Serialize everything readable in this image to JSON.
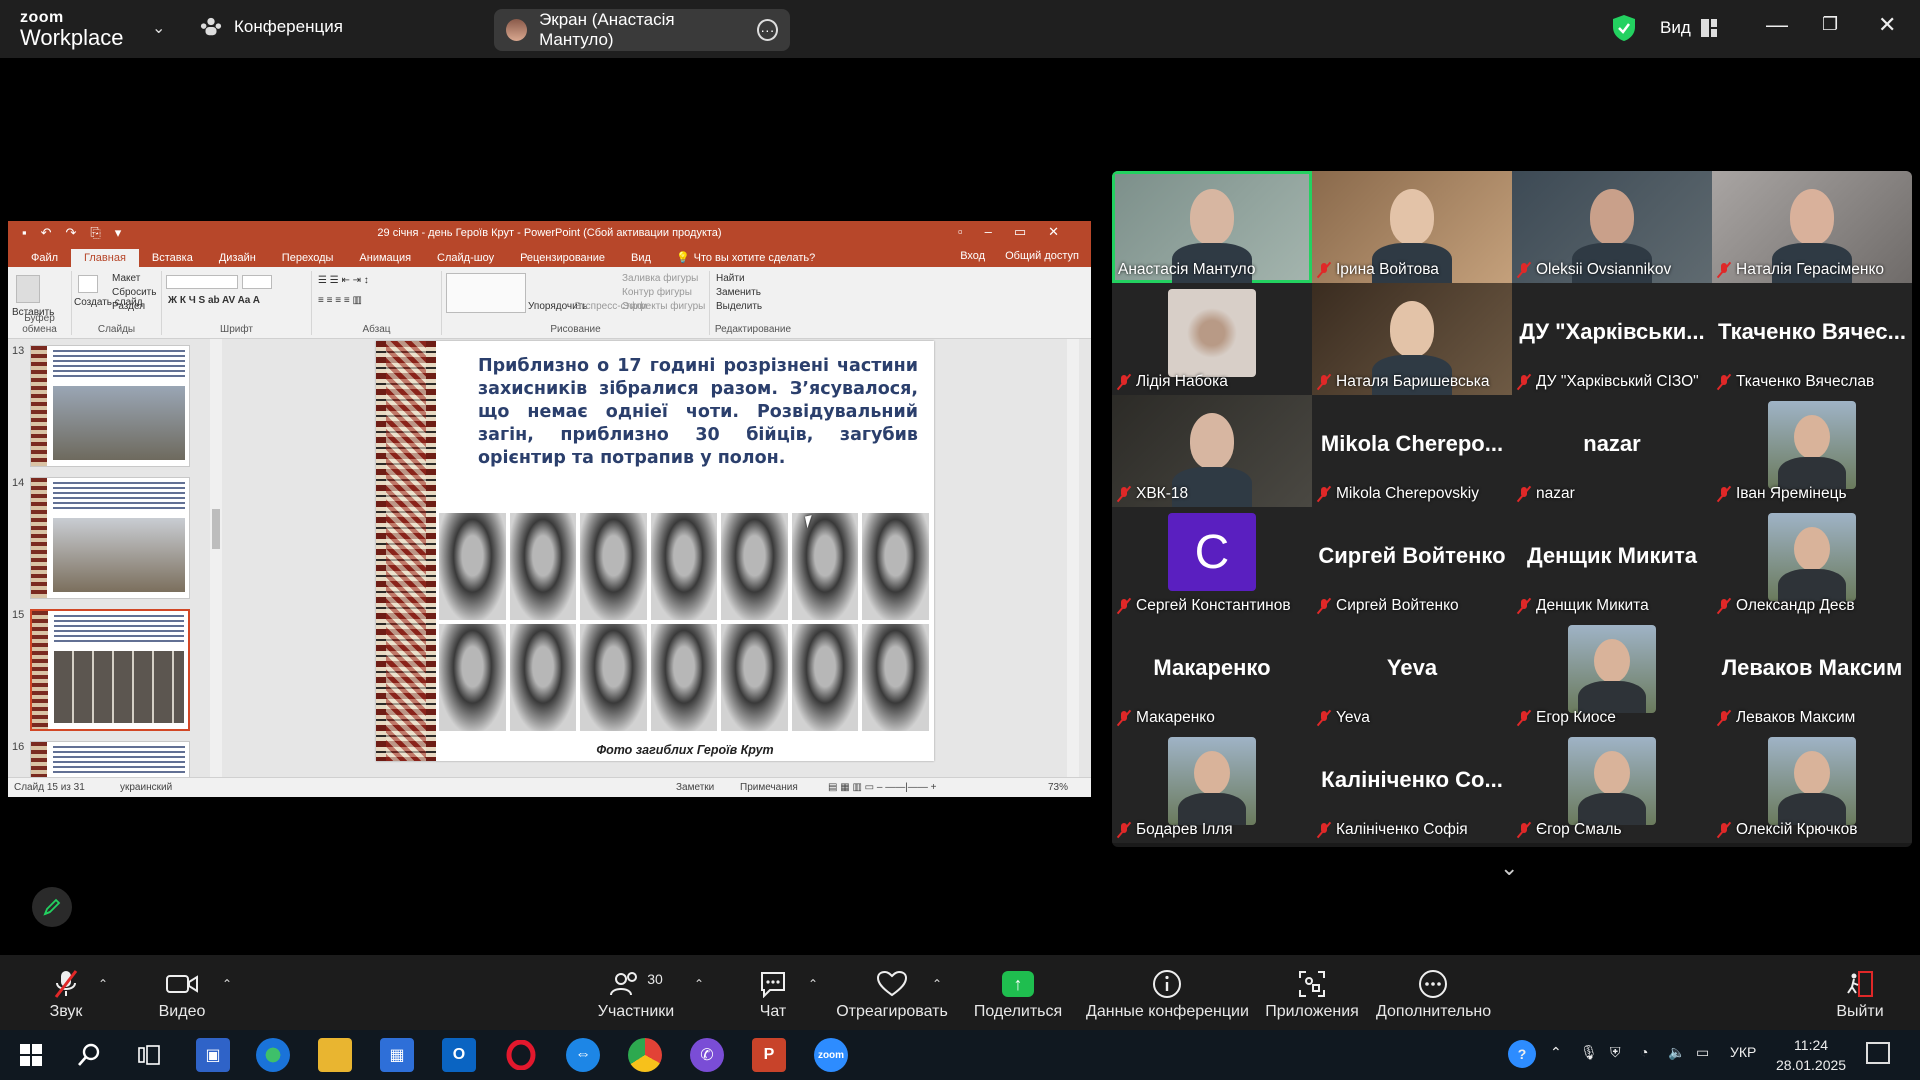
{
  "titlebar": {
    "logo_line1": "zoom",
    "logo_line2": "Workplace",
    "meeting_label": "Конференция",
    "screen_share_label": "Экран (Анастасія Мантуло)",
    "view_label": "Вид",
    "security_color": "#23d160"
  },
  "ppt": {
    "window_title": "29 січня - день Героїв Крут - PowerPoint (Сбой активации продукта)",
    "tabs": [
      "Файл",
      "Главная",
      "Вставка",
      "Дизайн",
      "Переходы",
      "Анимация",
      "Слайд-шоу",
      "Рецензирование",
      "Вид"
    ],
    "active_tab": "Главная",
    "tell_me": "Что вы хотите сделать?",
    "sign_in": "Вход",
    "share": "Общий доступ",
    "ribbon": {
      "paste": "Вставить",
      "clipboard": "Буфер обмена",
      "new_slide": "Создать слайд",
      "layout": "Макет",
      "reset": "Сбросить",
      "section": "Раздел",
      "slides": "Слайды",
      "font": "Шрифт",
      "paragraph": "Абзац",
      "arrange": "Упорядочить",
      "quick_styles": "Экспресс-стили",
      "shape_fill": "Заливка фигуры",
      "shape_outline": "Контур фигуры",
      "shape_effects": "Эффекты фигуры",
      "drawing": "Рисование",
      "find": "Найти",
      "replace": "Заменить",
      "select": "Выделить",
      "editing": "Редактирование"
    },
    "thumbnails": [
      {
        "num": "13",
        "selected": false
      },
      {
        "num": "14",
        "selected": false
      },
      {
        "num": "15",
        "selected": true
      },
      {
        "num": "16",
        "selected": false
      }
    ],
    "slide_text": "Приблизно о 17 годині розрізнені частини захисників зібралися разом. З’ясувалося, що немає одніеї чоти. Розвідувальний загін, приблизно 30 бійців, загубив орієнтир та потрапив у полон.",
    "slide_caption": "Фото загиблих Героїв Крут",
    "status_slide": "Слайд 15 из 31",
    "status_lang": "украинский",
    "status_notes": "Заметки",
    "status_comments": "Примечания",
    "status_zoom": "73%"
  },
  "gallery": {
    "participants": [
      {
        "name": "Анастасія Мантуло",
        "type": "video",
        "active": true
      },
      {
        "name": "Ірина Войтова",
        "type": "video"
      },
      {
        "name": "Oleksii Ovsiannikov",
        "type": "video"
      },
      {
        "name": "Наталія Герасіменко",
        "type": "video"
      },
      {
        "name": "Лідія Набока",
        "type": "photo"
      },
      {
        "name": "Наталя Баришевська",
        "type": "video"
      },
      {
        "name": "ДУ \"Харківський СІЗО\"",
        "big": "ДУ \"Харківськи...",
        "type": "text"
      },
      {
        "name": "Ткаченко Вячеслав",
        "big": "Ткаченко Вячес...",
        "type": "text"
      },
      {
        "name": "ХВК-18",
        "type": "video"
      },
      {
        "name": "Mikola Cherepovskiy",
        "big": "Mikola Cherepo...",
        "type": "text"
      },
      {
        "name": "nazar",
        "big": "nazar",
        "type": "text"
      },
      {
        "name": "Іван Яремінець",
        "type": "photo"
      },
      {
        "name": "Сергей Константинов",
        "type": "avatar",
        "initial": "C"
      },
      {
        "name": "Сиргей Войтенко",
        "big": "Сиргей Войтенко",
        "type": "text"
      },
      {
        "name": "Денщик Микита",
        "big": "Денщик Микита",
        "type": "text"
      },
      {
        "name": "Олександр Деєв",
        "type": "photo"
      },
      {
        "name": "Макаренко",
        "big": "Макаренко",
        "type": "text"
      },
      {
        "name": "Yeva",
        "big": "Yeva",
        "type": "text"
      },
      {
        "name": "Егор Киосе",
        "type": "photo"
      },
      {
        "name": "Леваков Максим",
        "big": "Леваков Максим",
        "type": "text"
      },
      {
        "name": "Бодарев Ілля",
        "type": "photo"
      },
      {
        "name": "Калініченко Софія",
        "big": "Калініченко Со...",
        "type": "text"
      },
      {
        "name": "Єгор Смаль",
        "type": "photo"
      },
      {
        "name": "Олексій Крючков",
        "type": "photo"
      }
    ]
  },
  "toolbar": {
    "mute": "Звук",
    "video": "Видео",
    "participants": "Участники",
    "participants_count": "30",
    "chat": "Чат",
    "react": "Отреагировать",
    "share": "Поделиться",
    "meeting_info": "Данные конференции",
    "apps": "Приложения",
    "more": "Дополнительно",
    "leave": "Выйти"
  },
  "taskbar": {
    "lang": "УКР",
    "time": "11:24",
    "date": "28.01.2025"
  }
}
